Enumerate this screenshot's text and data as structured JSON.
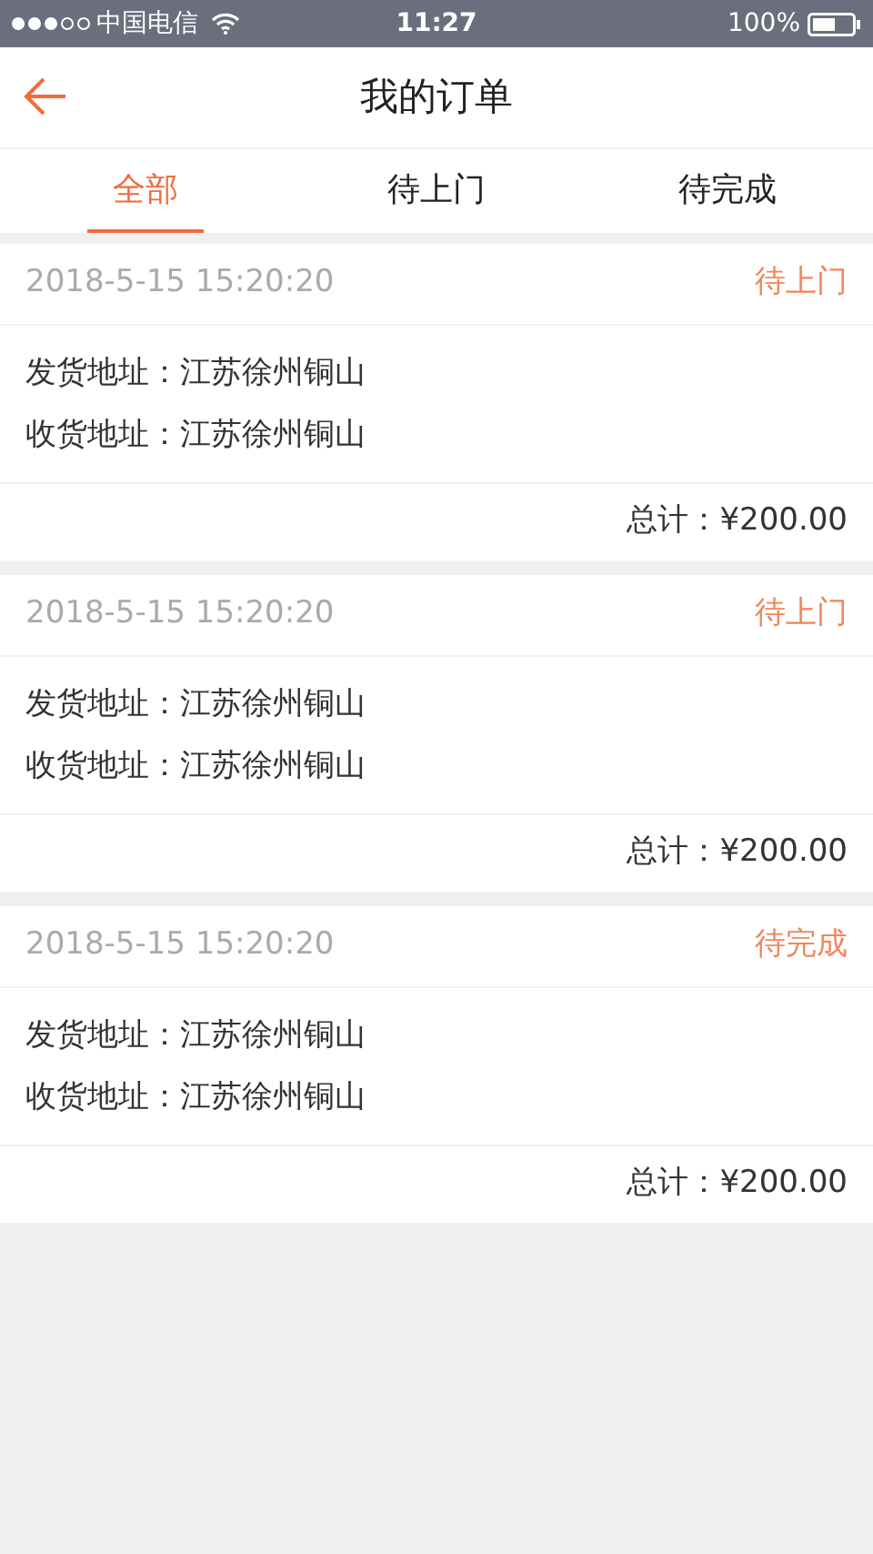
{
  "status_bar": {
    "carrier": "中国电信",
    "time": "11:27",
    "battery": "100%"
  },
  "header": {
    "title": "我的订单"
  },
  "tabs": [
    {
      "label": "全部",
      "selected": true
    },
    {
      "label": "待上门",
      "selected": false
    },
    {
      "label": "待完成",
      "selected": false
    }
  ],
  "orders": [
    {
      "time": "2018-5-15 15:20:20",
      "status": "待上门",
      "from": "发货地址：江苏徐州铜山",
      "to": "收货地址：江苏徐州铜山",
      "total": "总计：¥200.00"
    },
    {
      "time": "2018-5-15 15:20:20",
      "status": "待上门",
      "from": "发货地址：江苏徐州铜山",
      "to": "收货地址：江苏徐州铜山",
      "total": "总计：¥200.00"
    },
    {
      "time": "2018-5-15 15:20:20",
      "status": "待完成",
      "from": "发货地址：江苏徐州铜山",
      "to": "收货地址：江苏徐州铜山",
      "total": "总计：¥200.00"
    }
  ]
}
